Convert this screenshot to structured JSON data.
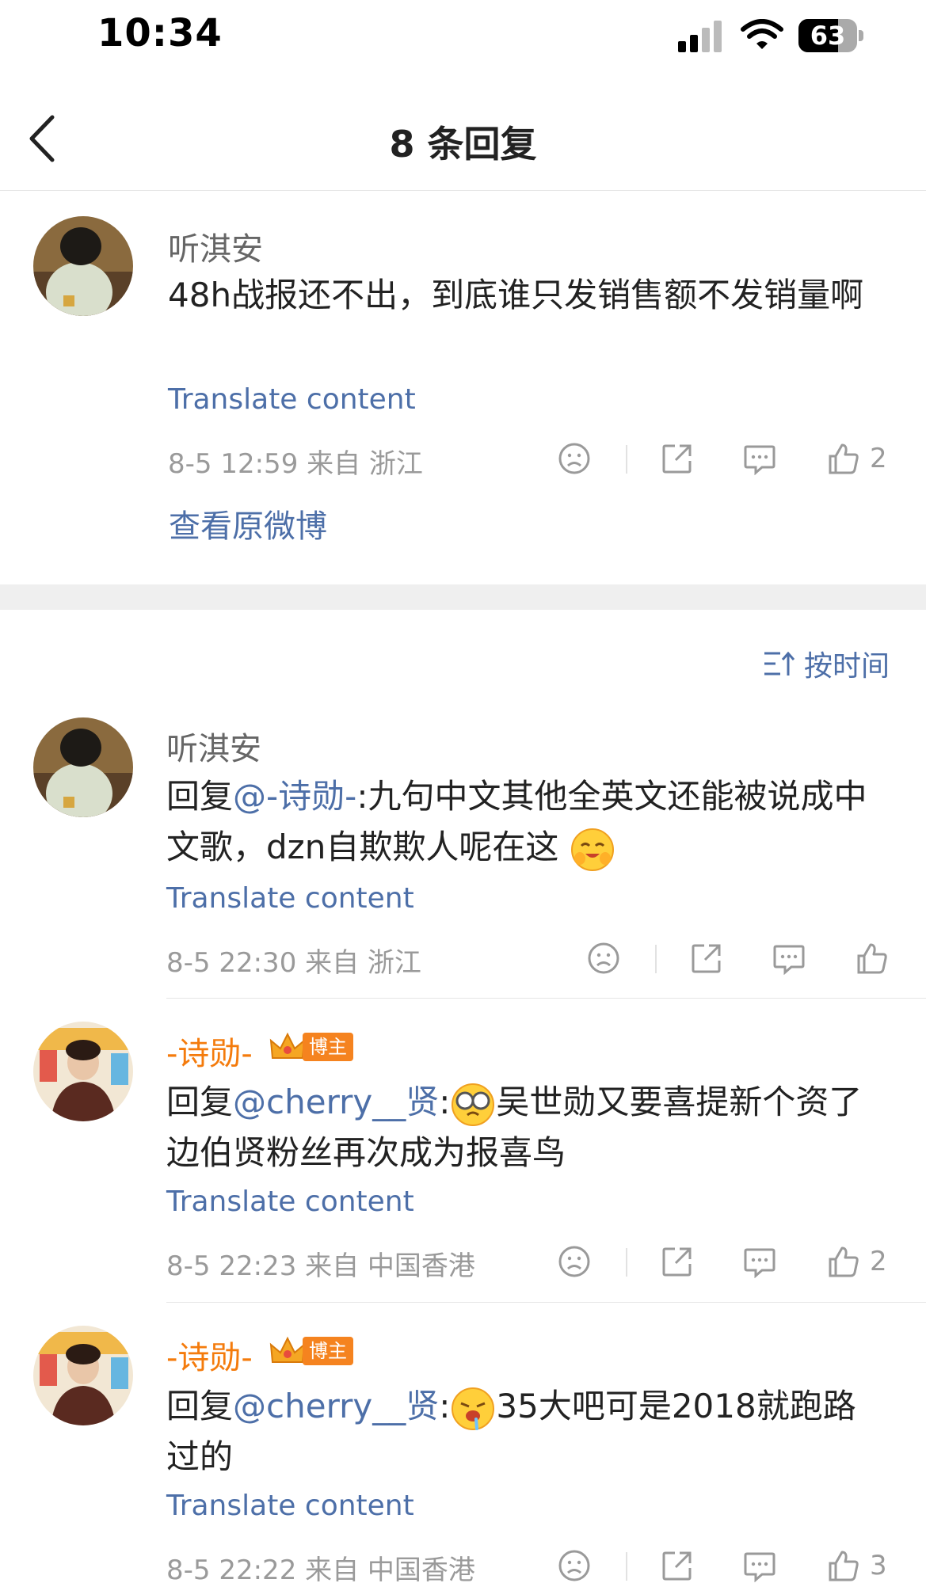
{
  "status_bar": {
    "time": "10:34",
    "battery": "63"
  },
  "nav": {
    "title": "8 条回复"
  },
  "root_comment": {
    "name": "听淇安",
    "text": "48h战报还不出，到底谁只发销售额不发销量啊",
    "translate": "Translate content",
    "meta": "8-5 12:59 来自 浙江",
    "likes": "2",
    "view_original": "查看原微博"
  },
  "sort": {
    "label": "按时间"
  },
  "replies": [
    {
      "name": "听淇安",
      "reply_prefix": "回复",
      "mention": "@-诗勋-",
      "text": ":九句中文其他全英文还能被说成中文歌，dzn自欺欺人呢在这",
      "translate": "Translate content",
      "meta": "8-5 22:30 来自 浙江",
      "likes": ""
    },
    {
      "name": "-诗勋-",
      "badge": "博主",
      "reply_prefix": "回复",
      "mention": "@cherry__贤",
      "text_after_emoji": "吴世勋又要喜提新个资了 边伯贤粉丝再次成为报喜鸟",
      "translate": "Translate content",
      "meta": "8-5 22:23 来自 中国香港",
      "likes": "2"
    },
    {
      "name": "-诗勋-",
      "badge": "博主",
      "reply_prefix": "回复",
      "mention": "@cherry__贤",
      "text_after_emoji": "35大吧可是2018就跑路过的",
      "translate": "Translate content",
      "meta": "8-5 22:22 来自 中国香港",
      "likes": "3"
    }
  ],
  "colors": {
    "link": "#4d6fa8",
    "vip": "#f47b0c",
    "meta": "#9a9a9a"
  }
}
